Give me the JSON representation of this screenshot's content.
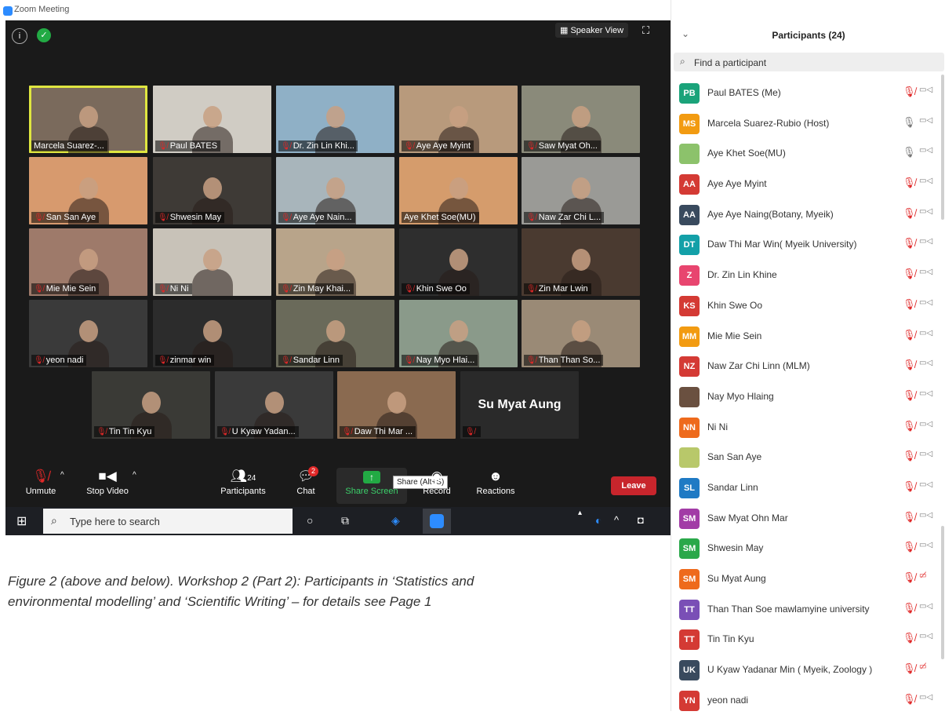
{
  "window": {
    "title": "Zoom Meeting",
    "minimize": "–",
    "maximize": "▫",
    "close": "✕"
  },
  "colors": {
    "accent": "#2d8cff",
    "mute": "#e02828",
    "active_speaker": "#dfe640",
    "leave": "#c8252c"
  },
  "top_bar": {
    "info_icon": "info-icon",
    "security_icon": "shield-icon",
    "speaker_view": "Speaker View",
    "fullscreen_icon": "fullscreen-icon"
  },
  "tiles": [
    {
      "name": "Marcela Suarez-...",
      "muted": false,
      "bg": "#7a6a5c"
    },
    {
      "name": "Paul BATES",
      "muted": true,
      "bg": "#d0ccc4"
    },
    {
      "name": "Dr. Zin Lin Khi...",
      "muted": true,
      "bg": "#8fb0c6"
    },
    {
      "name": "Aye Aye Myint",
      "muted": true,
      "bg": "#b89a7c"
    },
    {
      "name": "Saw Myat Oh...",
      "muted": true,
      "bg": "#8a8a7a"
    },
    {
      "name": "San San Aye",
      "muted": true,
      "bg": "#d79a6e"
    },
    {
      "name": "Shwesin May",
      "muted": true,
      "bg": "#3e3a36"
    },
    {
      "name": "Aye Aye Nain...",
      "muted": true,
      "bg": "#a8b5bb"
    },
    {
      "name": "Aye Khet Soe(MU)",
      "muted": false,
      "bg": "#d59c6c"
    },
    {
      "name": "Naw Zar Chi L...",
      "muted": true,
      "bg": "#9a9a96"
    },
    {
      "name": "Mie Mie Sein",
      "muted": true,
      "bg": "#9e7a6a"
    },
    {
      "name": "Ni Ni",
      "muted": true,
      "bg": "#c8c2b8"
    },
    {
      "name": "Zin May Khai...",
      "muted": true,
      "bg": "#b8a48a"
    },
    {
      "name": "Khin Swe Oo",
      "muted": true,
      "bg": "#2e2e2e"
    },
    {
      "name": "Zin Mar Lwin",
      "muted": true,
      "bg": "#4a3a30"
    },
    {
      "name": "yeon nadi",
      "muted": true,
      "bg": "#3a3a3a"
    },
    {
      "name": "zinmar win",
      "muted": true,
      "bg": "#2c2c2c"
    },
    {
      "name": "Sandar Linn",
      "muted": true,
      "bg": "#6a6a5a"
    },
    {
      "name": "Nay Myo Hlai...",
      "muted": true,
      "bg": "#8a9a8a"
    },
    {
      "name": "Than Than So...",
      "muted": true,
      "bg": "#9a8a76"
    },
    {
      "name": "Tin Tin Kyu",
      "muted": true,
      "bg": "#3a3a36"
    },
    {
      "name": "U Kyaw Yadan...",
      "muted": true,
      "bg": "#3a3a3a"
    },
    {
      "name": "Daw Thi Mar ...",
      "muted": true,
      "bg": "#8a6a50"
    },
    {
      "name": "",
      "muted": true,
      "bg": "#2a2a2a",
      "big_name": "Su Myat Aung"
    }
  ],
  "toolbar": {
    "unmute": "Unmute",
    "stop_video": "Stop Video",
    "participants": "Participants",
    "participants_count": "24",
    "chat": "Chat",
    "chat_badge": "2",
    "share_screen": "Share Screen",
    "share_tooltip": "Share (Alt+S)",
    "record": "Record",
    "reactions": "Reactions",
    "leave": "Leave"
  },
  "taskbar": {
    "search_placeholder": "Type here to search"
  },
  "caption": {
    "line1": "Figure 2 (above and below). Workshop 2 (Part 2): Participants in ‘Statistics and",
    "line2": "environmental modelling’ and ‘Scientific Writing’ – for details see Page 1"
  },
  "panel": {
    "title": "Participants (24)",
    "search_placeholder": "Find a participant",
    "participants": [
      {
        "initials": "PB",
        "color": "#1aa37a",
        "name": "Paul BATES (Me)",
        "mic": "muted",
        "cam": "on"
      },
      {
        "initials": "MS",
        "color": "#f29b11",
        "name": "Marcela Suarez-Rubio (Host)",
        "mic": "on",
        "cam": "on"
      },
      {
        "initials": "",
        "color": "#8cc26b",
        "name": "Aye Khet Soe(MU)",
        "mic": "on",
        "cam": "on",
        "photo": true
      },
      {
        "initials": "AA",
        "color": "#d43a34",
        "name": "Aye Aye Myint",
        "mic": "muted",
        "cam": "on"
      },
      {
        "initials": "AA",
        "color": "#394a5e",
        "name": "Aye Aye Naing(Botany, Myeik)",
        "mic": "muted",
        "cam": "on"
      },
      {
        "initials": "DT",
        "color": "#13a0a8",
        "name": "Daw Thi Mar Win( Myeik University)",
        "mic": "muted",
        "cam": "on"
      },
      {
        "initials": "Z",
        "color": "#e8456f",
        "name": "Dr. Zin Lin Khine",
        "mic": "muted",
        "cam": "on"
      },
      {
        "initials": "KS",
        "color": "#d43a34",
        "name": "Khin Swe Oo",
        "mic": "muted",
        "cam": "on"
      },
      {
        "initials": "MM",
        "color": "#f29b11",
        "name": "Mie Mie Sein",
        "mic": "muted",
        "cam": "on"
      },
      {
        "initials": "NZ",
        "color": "#d43a34",
        "name": "Naw Zar Chi Linn (MLM)",
        "mic": "muted",
        "cam": "on"
      },
      {
        "initials": "",
        "color": "#6a5040",
        "name": "Nay Myo Hlaing",
        "mic": "muted",
        "cam": "on",
        "photo": true
      },
      {
        "initials": "NN",
        "color": "#ee6a1c",
        "name": "Ni Ni",
        "mic": "muted",
        "cam": "on"
      },
      {
        "initials": "",
        "color": "#b8c86a",
        "name": "San San Aye",
        "mic": "muted",
        "cam": "on",
        "photo": true
      },
      {
        "initials": "SL",
        "color": "#1f7ac4",
        "name": "Sandar Linn",
        "mic": "muted",
        "cam": "on"
      },
      {
        "initials": "SM",
        "color": "#a23ba6",
        "name": "Saw Myat Ohn Mar",
        "mic": "muted",
        "cam": "on"
      },
      {
        "initials": "SM",
        "color": "#2aa84a",
        "name": "Shwesin May",
        "mic": "muted",
        "cam": "on"
      },
      {
        "initials": "SM",
        "color": "#ee6a1c",
        "name": "Su Myat Aung",
        "mic": "muted",
        "cam": "off"
      },
      {
        "initials": "TT",
        "color": "#7a4fb6",
        "name": "Than Than Soe mawlamyine university",
        "mic": "muted",
        "cam": "on"
      },
      {
        "initials": "TT",
        "color": "#d43a34",
        "name": "Tin Tin Kyu",
        "mic": "muted",
        "cam": "on"
      },
      {
        "initials": "UK",
        "color": "#394a5e",
        "name": "U Kyaw Yadanar Min ( Myeik, Zoology )",
        "mic": "muted",
        "cam": "off"
      },
      {
        "initials": "YN",
        "color": "#d43a34",
        "name": "yeon nadi",
        "mic": "muted",
        "cam": "on"
      }
    ]
  }
}
